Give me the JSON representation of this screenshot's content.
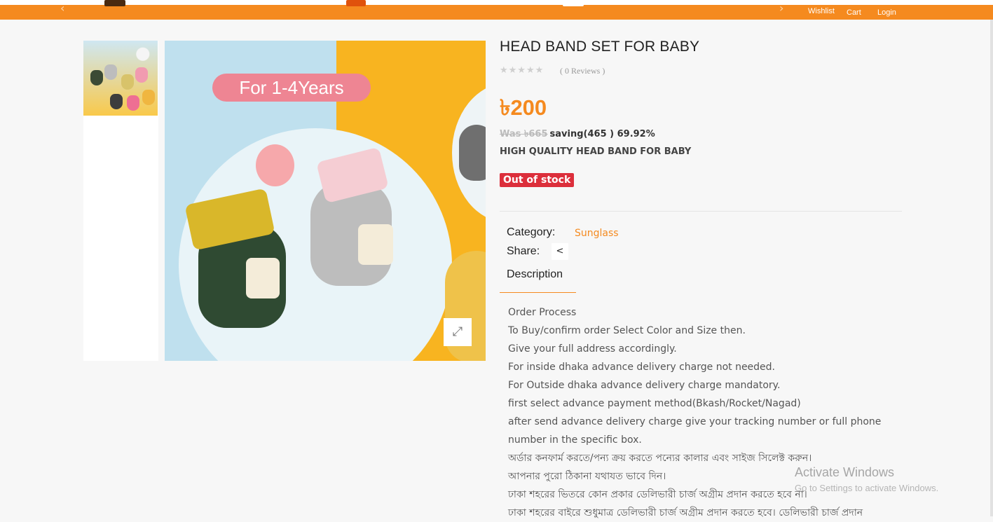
{
  "header": {
    "wishlist_label": "Wishlist",
    "cart_label": "Cart",
    "login_label": "Login",
    "accent": "#f58a1f"
  },
  "gallery": {
    "badge_text": "For 1-4Years",
    "expand_icon": "expand-icon"
  },
  "product": {
    "title": "HEAD BAND SET FOR BABY",
    "rating_stars": "★★★★★",
    "reviews": "( 0 Reviews )",
    "price": "৳200",
    "was_price": "Was ৳665",
    "saving": "saving(465 ) 69.92%",
    "short_description": "HIGH QUALITY HEAD BAND FOR BABY",
    "stock_status": "Out of stock",
    "stock_color": "#dc2f3b"
  },
  "meta": {
    "category_label": "Category:",
    "category_value": "Sunglass",
    "share_label": "Share:",
    "description_tab": "Description"
  },
  "description": {
    "lines": [
      "Order Process",
      "To Buy/confirm order Select Color and Size then.",
      "Give your full address accordingly.",
      "For inside dhaka advance delivery charge not needed.",
      "For Outside dhaka advance delivery charge mandatory.",
      "first select advance payment method(Bkash/Rocket/Nagad)",
      "after send advance delivery charge give your tracking number or full phone",
      "number in the specific box.",
      "অর্ডার কনফার্ম করতে/পন্য ক্রয় করতে পন্যের কালার এবং সাইজ সিলেক্ট করুন।",
      "আপনার পুরো ঠিকানা যথাযত ভাবে দিন।",
      "ঢাকা শহরের ভিতরে কোন প্রকার ডেলিভারী চার্জ অগ্রীম প্রদান করতে হবে না।",
      "ঢাকা শহরের বাইরে শুধুমাত্র ডেলিভারী চার্জ অগ্রীম প্রদান করতে হবে। ডেলিভারী চার্জ প্রদান"
    ]
  },
  "system": {
    "activate_title": "Activate Windows",
    "activate_sub": "Go to Settings to activate Windows."
  }
}
